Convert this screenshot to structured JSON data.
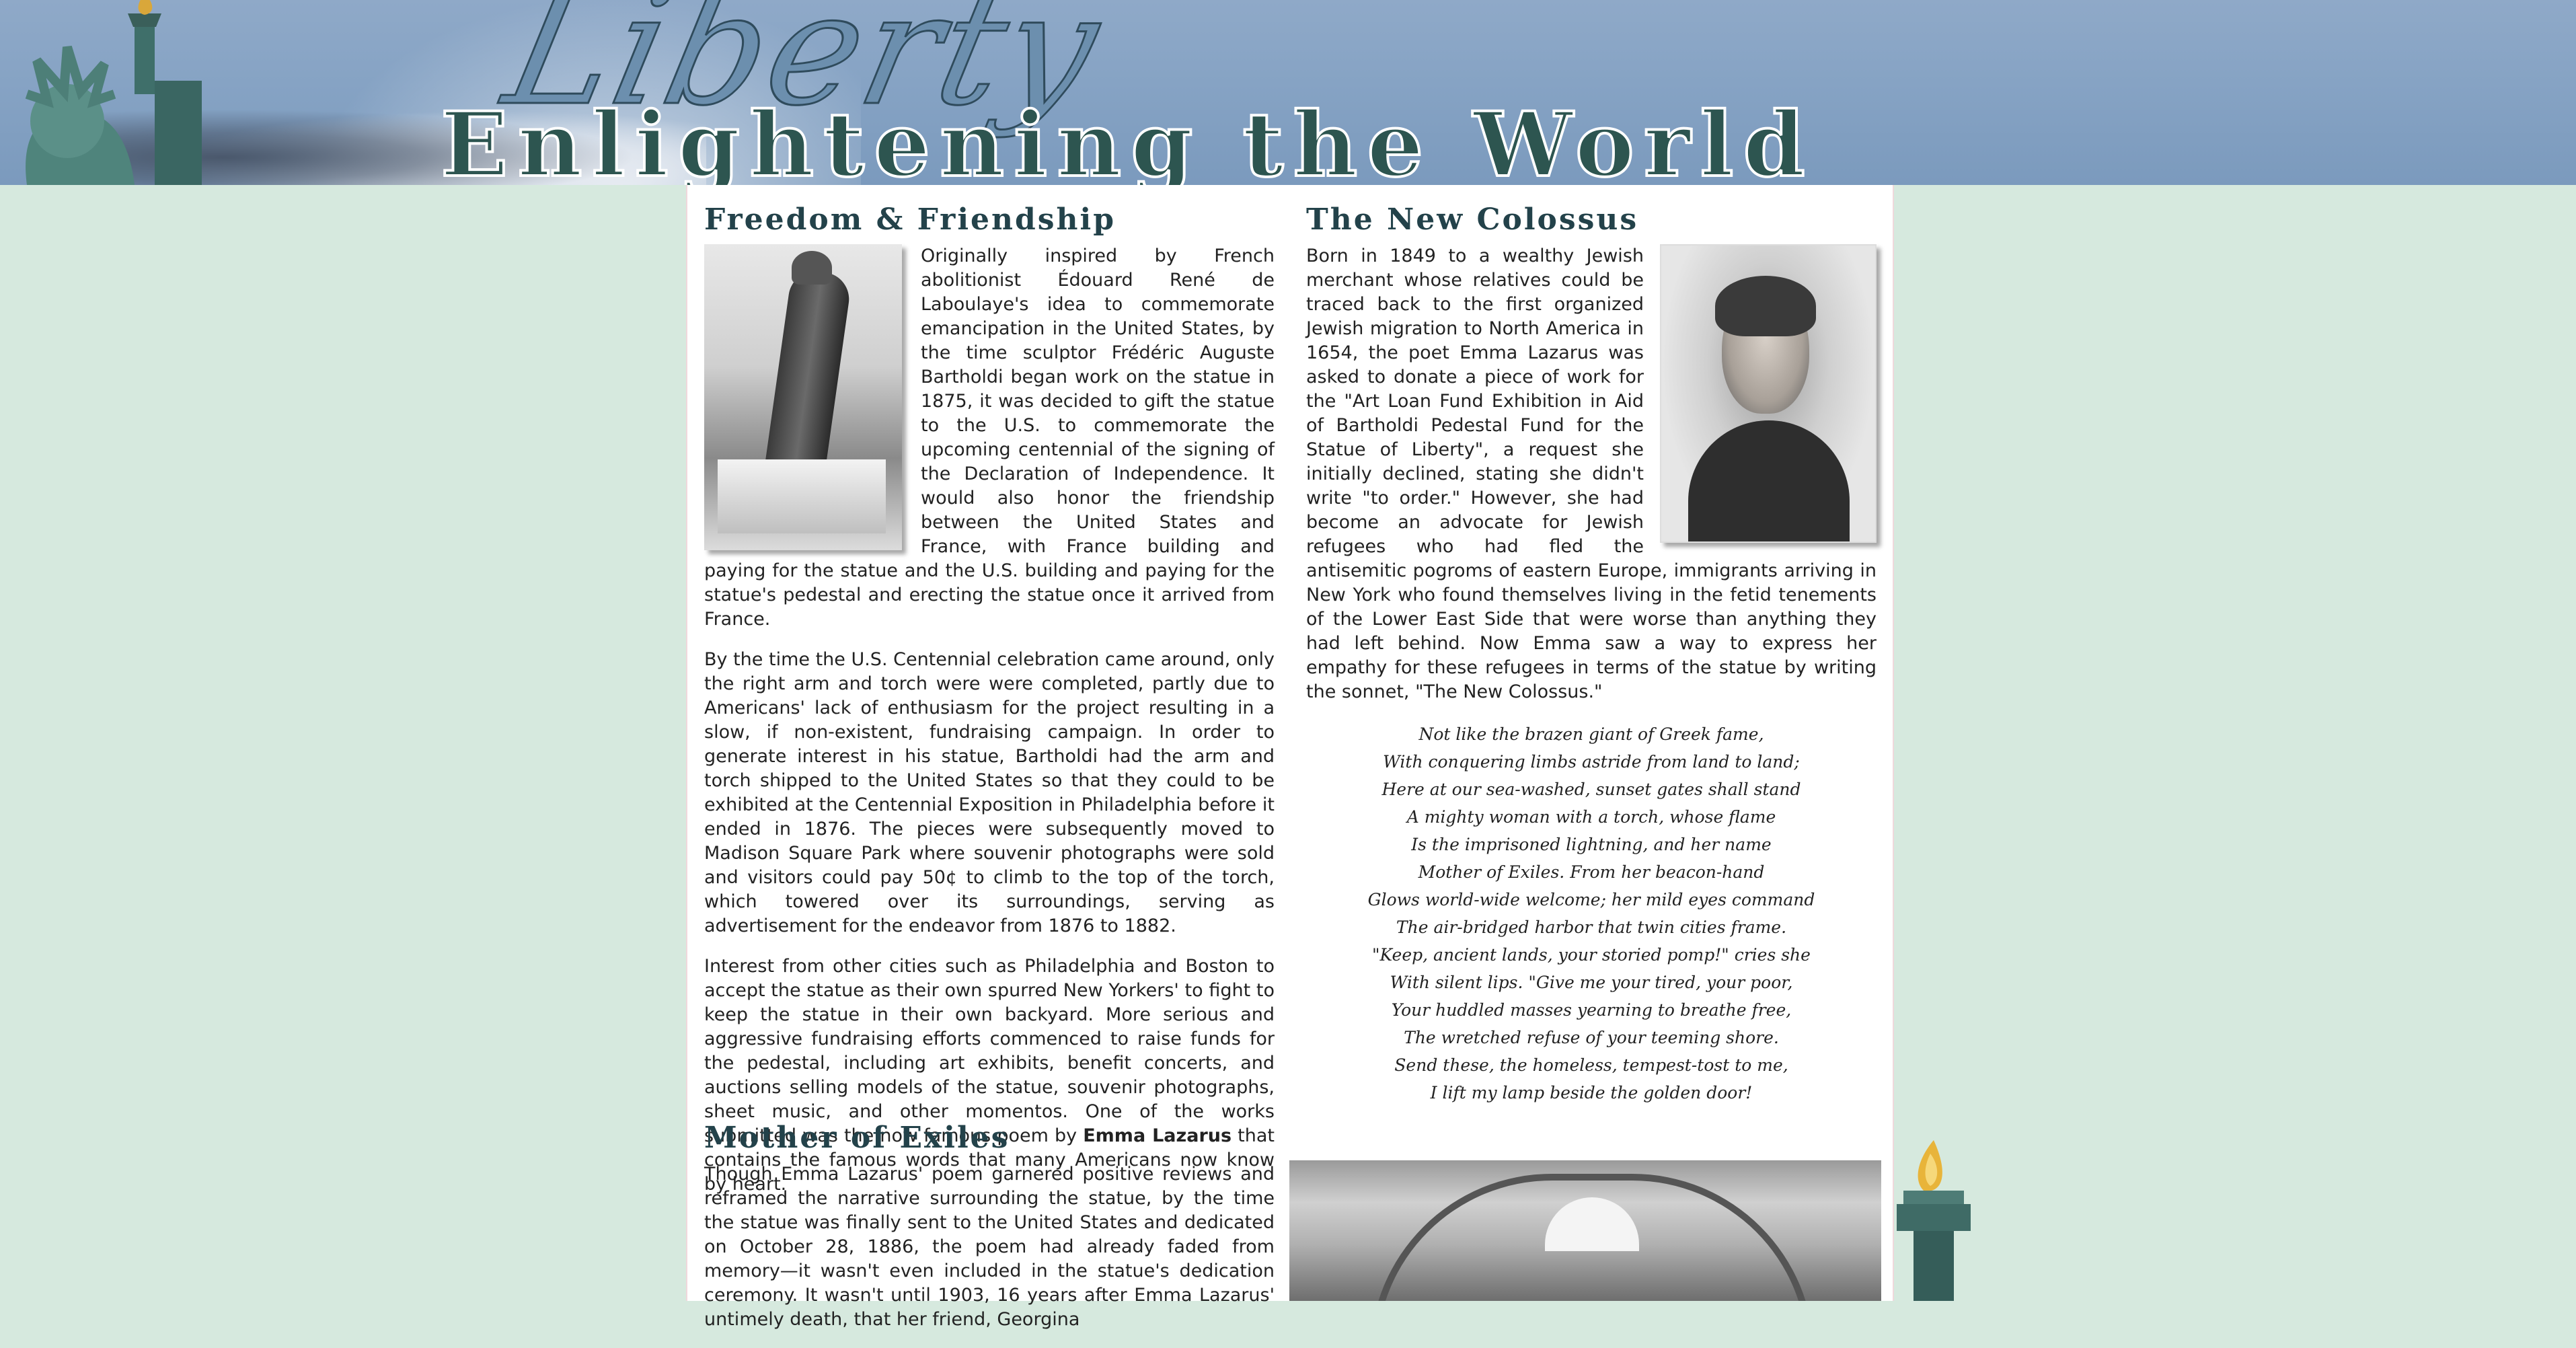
{
  "header": {
    "script_title": "Liberty",
    "main_title": "Enlightening the World"
  },
  "freedom": {
    "heading": "Freedom & Friendship",
    "p1": "Originally inspired by French abolitionist Édouard René de Laboulaye's idea to commemorate emancipation in the United States, by the time sculptor Frédéric Auguste Bartholdi began work on the statue in 1875, it was decided to gift the statue to the U.S. to commemorate the upcoming centennial of the signing of the Declaration of Independence. It would also honor the friendship between the United States and France, with France building and paying for the statue and the U.S. building and paying for the statue's pedestal and erecting the statue once it arrived from France.",
    "p2": "By the time the U.S. Centennial celebration came around, only the right arm and torch were were completed, partly due to Americans' lack of enthusiasm for the project resulting in a slow, if non-existent, fundraising campaign. In order to generate interest in his statue, Bartholdi had the arm and torch shipped to the United States so that they could to be exhibited at the Centennial Exposition in Philadelphia before it ended in 1876. The pieces were subsequently moved to Madison Square Park where souvenir photographs were sold and visitors could pay 50¢ to climb to the top of the torch, which towered over its surroundings, serving as advertisement for the endeavor from 1876 to 1882.",
    "p3_before": "Interest from other cities such as Philadelphia and Boston to accept the statue as their own spurred New Yorkers' to fight to keep the statue in their own backyard. More serious and aggressive fundraising efforts commenced to raise funds for the pedestal, including art exhibits, benefit concerts, and auctions selling models of the statue, souvenir photographs, sheet music, and other momentos. One of the works submitted was the now famous poem by ",
    "p3_bold": "Emma Lazarus",
    "p3_after": " that contains the famous words that many Americans now know by heart."
  },
  "colossus": {
    "heading": "The New Colossus",
    "p1": "Born in 1849 to a wealthy Jewish merchant whose relatives could be traced back to the first organized Jewish migration to North America in 1654, the poet Emma Lazarus was asked to donate a piece of work for the \"Art Loan Fund Exhibition in Aid of Bartholdi Pedestal Fund for the Statue of Liberty\", a request she initially declined, stating she didn't write \"to order.\" However, she had become an advocate for Jewish refugees who had fled the antisemitic pogroms of eastern Europe, immigrants arriving in New York who found themselves living in the fetid tenements of the Lower East Side that were worse than anything they had left behind. Now Emma saw a way to express her empathy for these refugees in terms of the statue by writing the sonnet, \"The New Colossus.\"",
    "poem": [
      "Not like the brazen giant of Greek fame,",
      "With conquering limbs astride from land to land;",
      "Here at our sea-washed, sunset gates shall stand",
      "A mighty woman with a torch, whose flame",
      "Is the imprisoned lightning, and her name",
      "Mother of Exiles. From her beacon-hand",
      "Glows world-wide welcome; her mild eyes command",
      "The air-bridged harbor that twin cities frame.",
      "\"Keep, ancient lands, your storied pomp!\" cries she",
      "With silent lips. \"Give me your tired, your poor,",
      "Your huddled masses yearning to breathe free,",
      "The wretched refuse of your teeming shore.",
      "Send these, the homeless, tempest-tost to me,",
      "I lift my lamp beside the golden door!"
    ]
  },
  "exiles": {
    "heading": "Mother of Exiles",
    "p1": "Though Emma Lazarus' poem garnered positive reviews and reframed the narrative surrounding the statue, by the time the statue was finally sent to the United States and dedicated on October 28, 1886, the poem had already faded from memory—it wasn't even included in the statue's dedication ceremony. It wasn't until 1903, 16 years after Emma Lazarus' untimely death, that her friend, Georgina"
  }
}
